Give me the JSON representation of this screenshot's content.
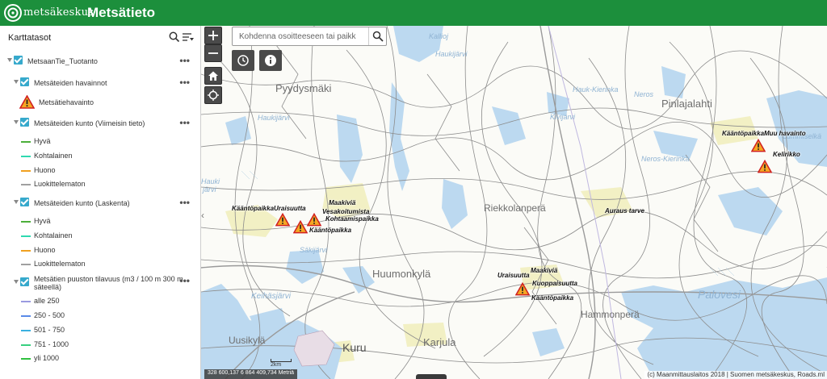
{
  "header": {
    "logo_text": "metsäkeskus",
    "app_title": "Metsätieto",
    "bg_color": "#1c8f3c"
  },
  "layer_panel": {
    "title": "Karttatasot",
    "tools": [
      "search-icon",
      "filter-list-icon"
    ],
    "root_group": {
      "label": "MetsaanTie_Tuotanto"
    },
    "groups": [
      {
        "label": "Metsäteiden havainnot",
        "legend": [
          {
            "label": "Metsätiehavainto",
            "symbol": "warning-triangle-icon"
          }
        ]
      },
      {
        "label": "Metsäteiden kunto (Viimeisin tieto)",
        "legend": [
          {
            "label": "Hyvä",
            "color": "#4caf3a"
          },
          {
            "label": "Kohtalainen",
            "color": "#2fd9b0"
          },
          {
            "label": "Huono",
            "color": "#f0a020"
          },
          {
            "label": "Luokittelematon",
            "color": "#a0a0a0"
          }
        ]
      },
      {
        "label": "Metsäteiden kunto (Laskenta)",
        "legend": [
          {
            "label": "Hyvä",
            "color": "#4caf3a"
          },
          {
            "label": "Kohtalainen",
            "color": "#2fd9b0"
          },
          {
            "label": "Huono",
            "color": "#f0a020"
          },
          {
            "label": "Luokittelematon",
            "color": "#a0a0a0"
          }
        ]
      },
      {
        "label_line1": "Metsätien puuston tilavuus (m3 / 100 m 300 m",
        "label_line2": "säteellä)",
        "legend": [
          {
            "label": "alle 250",
            "color": "#9a9ae0"
          },
          {
            "label": "250 - 500",
            "color": "#5a8ae8"
          },
          {
            "label": "501 - 750",
            "color": "#3ab0e0"
          },
          {
            "label": "751 - 1000",
            "color": "#38d080"
          },
          {
            "label": "yli 1000",
            "color": "#30c040"
          }
        ]
      }
    ]
  },
  "map": {
    "search": {
      "placeholder": "Kohdenna osoitteeseen tai paikk"
    },
    "controls": [
      "zoom-in-icon",
      "zoom-out-icon",
      "home-icon",
      "locate-icon",
      "history-icon",
      "info-icon"
    ],
    "place_labels": [
      "Pyydysmäki",
      "Pinlajalahti",
      "Riekkolanperä",
      "Huumonkylä",
      "Hammonperä",
      "Kuru",
      "Karjula",
      "Uusikylä"
    ],
    "water_labels": [
      "Kallioj",
      "Haukijärvi",
      "Haukijärvi",
      "Kivijärvi",
      "Lummiselkä",
      "Neros",
      "Hauk-Kierinka",
      "Neros-Kierinka",
      "Säkijärvi",
      "Keihäsjärvi",
      "Palovesi",
      "Hauki",
      "järvi"
    ],
    "incident_labels": [
      "KääntöpaikkaUraisuutta",
      "Maakiviä",
      "Vesakoitumista",
      "Kohtaamispaikka",
      "Kääntöpaikka",
      "Auraus tarve",
      "KääntöpaikkaMuu havainto",
      "Kelirikko",
      "Maakiviä",
      "Uraisuutta",
      "Kuoppaisuutta",
      "Kääntöpaikka"
    ],
    "scale_text": "2km",
    "coords_text": "328 600,137 6 864 409,734 Metriä",
    "attribution": "(c) Maanmittauslaitos 2018 | Suomen metsäkeskus, Roads.ml"
  }
}
